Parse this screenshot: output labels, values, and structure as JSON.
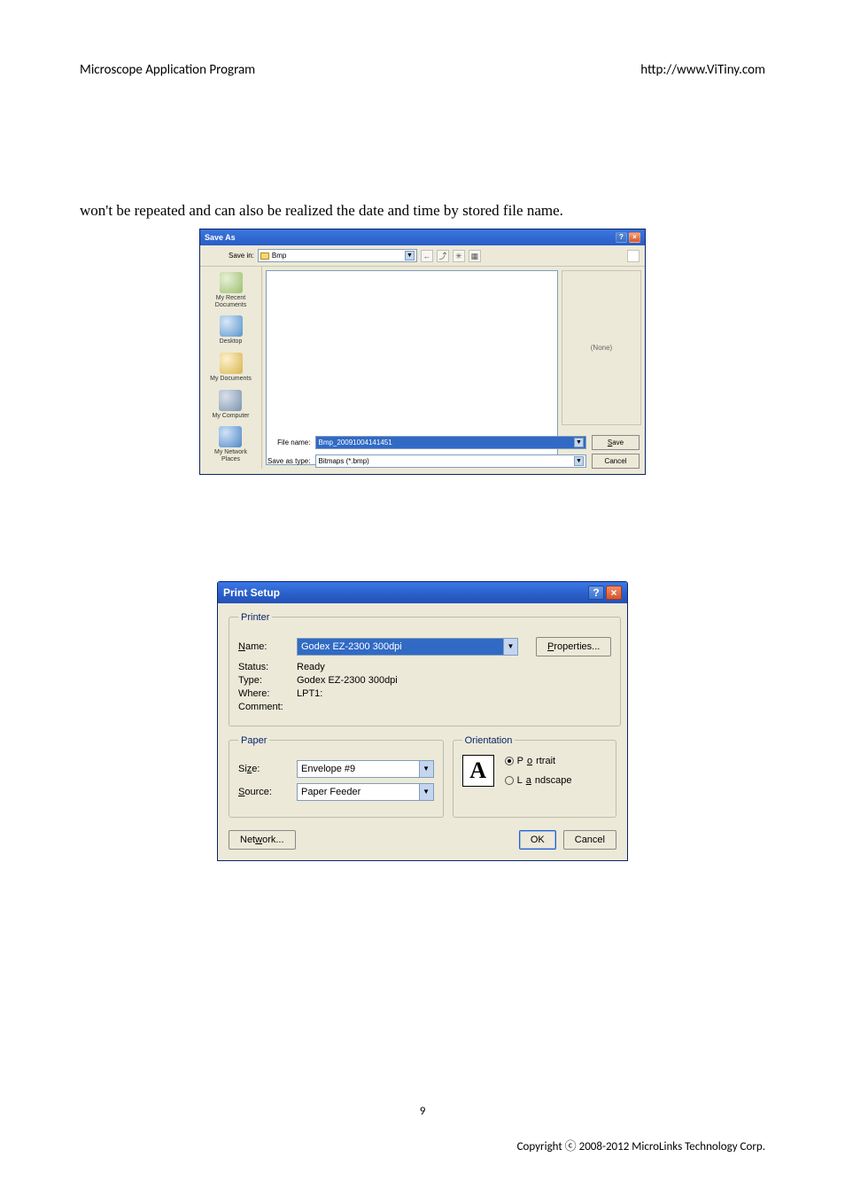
{
  "header": {
    "left": "Microscope Application Program",
    "right": "http://www.ViTiny.com"
  },
  "body_text": "won't be repeated and can also be realized the date and time by stored file name.",
  "saveas": {
    "title": "Save As",
    "savein_label": "Save in:",
    "savein_value": "Bmp",
    "places": {
      "recent": "My Recent\nDocuments",
      "desktop": "Desktop",
      "mydocs": "My Documents",
      "mycomp": "My Computer",
      "mynet": "My Network\nPlaces"
    },
    "preview": "(None)",
    "filename_label": "File name:",
    "filename_value": "Bmp_20091004141451",
    "saveastype_label": "Save as type:",
    "saveastype_value": "Bitmaps (*.bmp)",
    "save_btn": "Save",
    "cancel_btn": "Cancel"
  },
  "printsetup": {
    "title": "Print Setup",
    "printer_legend": "Printer",
    "name_label": "Name:",
    "name_value": "Godex EZ-2300 300dpi",
    "properties_btn": "Properties...",
    "status_label": "Status:",
    "status_value": "Ready",
    "type_label": "Type:",
    "type_value": "Godex EZ-2300 300dpi",
    "where_label": "Where:",
    "where_value": "LPT1:",
    "comment_label": "Comment:",
    "comment_value": "",
    "paper_legend": "Paper",
    "size_label": "Size:",
    "size_value": "Envelope #9",
    "source_label": "Source:",
    "source_value": "Paper Feeder",
    "orientation_legend": "Orientation",
    "orient_icon": "A",
    "portrait_label": "Portrait",
    "landscape_label": "Landscape",
    "network_btn": "Network...",
    "ok_btn": "OK",
    "cancel_btn": "Cancel"
  },
  "footer": {
    "page_num": "9",
    "copyright": "Copyright ⓒ 2008-2012 MicroLinks Technology Corp."
  }
}
